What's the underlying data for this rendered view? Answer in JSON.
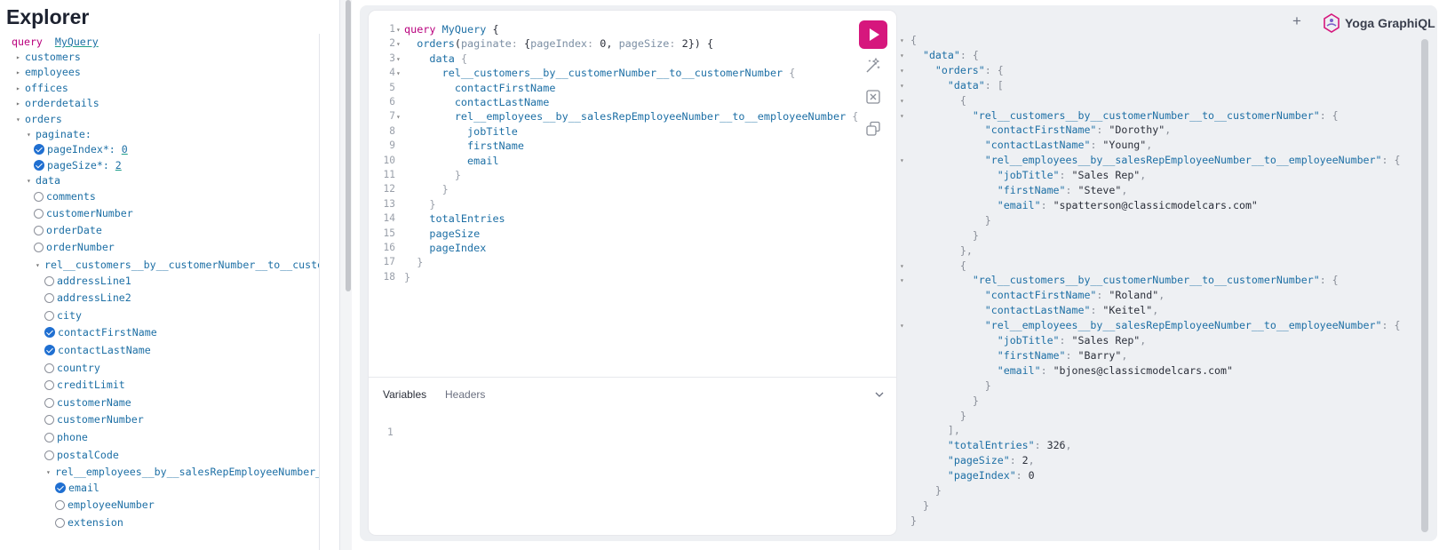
{
  "explorer": {
    "title": "Explorer",
    "query_keyword": "query",
    "operation_name": "MyQuery",
    "items": [
      {
        "label": "customers",
        "type": "collapsed"
      },
      {
        "label": "employees",
        "type": "collapsed"
      },
      {
        "label": "offices",
        "type": "collapsed"
      },
      {
        "label": "orderdetails",
        "type": "collapsed"
      },
      {
        "label": "orders",
        "type": "expanded"
      },
      {
        "label": "paginate:",
        "type": "expanded"
      },
      {
        "label": "pageIndex*:",
        "value": "0",
        "type": "checked"
      },
      {
        "label": "pageSize*:",
        "value": "2",
        "type": "checked"
      },
      {
        "label": "data",
        "type": "expanded"
      },
      {
        "label": "comments",
        "type": "unchecked"
      },
      {
        "label": "customerNumber",
        "type": "unchecked"
      },
      {
        "label": "orderDate",
        "type": "unchecked"
      },
      {
        "label": "orderNumber",
        "type": "unchecked"
      },
      {
        "label": "rel__customers__by__customerNumber__to__custom",
        "type": "expanded"
      },
      {
        "label": "addressLine1",
        "type": "unchecked"
      },
      {
        "label": "addressLine2",
        "type": "unchecked"
      },
      {
        "label": "city",
        "type": "unchecked"
      },
      {
        "label": "contactFirstName",
        "type": "checked"
      },
      {
        "label": "contactLastName",
        "type": "checked"
      },
      {
        "label": "country",
        "type": "unchecked"
      },
      {
        "label": "creditLimit",
        "type": "unchecked"
      },
      {
        "label": "customerName",
        "type": "unchecked"
      },
      {
        "label": "customerNumber",
        "type": "unchecked"
      },
      {
        "label": "phone",
        "type": "unchecked"
      },
      {
        "label": "postalCode",
        "type": "unchecked"
      },
      {
        "label": "rel__employees__by__salesRepEmployeeNumber__",
        "type": "expanded"
      },
      {
        "label": "email",
        "type": "checked"
      },
      {
        "label": "employeeNumber",
        "type": "unchecked"
      },
      {
        "label": "extension",
        "type": "unchecked"
      }
    ]
  },
  "editor": {
    "line_numbers": [
      "1",
      "2",
      "3",
      "4",
      "5",
      "6",
      "7",
      "8",
      "9",
      "10",
      "11",
      "12",
      "13",
      "14",
      "15",
      "16",
      "17",
      "18"
    ],
    "lines": [
      "query MyQuery {",
      "  orders(paginate: {pageIndex: 0, pageSize: 2}) {",
      "    data {",
      "      rel__customers__by__customerNumber__to__customerNumber {",
      "        contactFirstName",
      "        contactLastName",
      "        rel__employees__by__salesRepEmployeeNumber__to__employeeNumber {",
      "          jobTitle",
      "          firstName",
      "          email",
      "        }",
      "      }",
      "    }",
      "    totalEntries",
      "    pageSize",
      "    pageIndex",
      "  }",
      "}"
    ]
  },
  "tools": {
    "run_icon": "play-icon",
    "prettify_icon": "prettify-icon",
    "merge_icon": "merge-fragments-icon",
    "copy_icon": "copy-icon"
  },
  "variables_panel": {
    "tab_variables": "Variables",
    "tab_headers": "Headers",
    "line_number": "1"
  },
  "header": {
    "plus": "+",
    "logo_text": "Yoga GraphiQL"
  },
  "result": {
    "lines": [
      "{",
      "  \"data\": {",
      "    \"orders\": {",
      "      \"data\": [",
      "        {",
      "          \"rel__customers__by__customerNumber__to__customerNumber\": {",
      "            \"contactFirstName\": \"Dorothy\",",
      "            \"contactLastName\": \"Young\",",
      "            \"rel__employees__by__salesRepEmployeeNumber__to__employeeNumber\": {",
      "              \"jobTitle\": \"Sales Rep\",",
      "              \"firstName\": \"Steve\",",
      "              \"email\": \"spatterson@classicmodelcars.com\"",
      "            }",
      "          }",
      "        },",
      "        {",
      "          \"rel__customers__by__customerNumber__to__customerNumber\": {",
      "            \"contactFirstName\": \"Roland\",",
      "            \"contactLastName\": \"Keitel\",",
      "            \"rel__employees__by__salesRepEmployeeNumber__to__employeeNumber\": {",
      "              \"jobTitle\": \"Sales Rep\",",
      "              \"firstName\": \"Barry\",",
      "              \"email\": \"bjones@classicmodelcars.com\"",
      "            }",
      "          }",
      "        }",
      "      ],",
      "      \"totalEntries\": 326,",
      "      \"pageSize\": 2,",
      "      \"pageIndex\": 0",
      "    }",
      "  }",
      "}"
    ]
  },
  "colors": {
    "accent": "#d6177d",
    "check": "#1f6fd1",
    "keyword": "#b9007d",
    "field": "#1d6fa5",
    "string": "#c8571c",
    "number": "#2b8a3e"
  }
}
